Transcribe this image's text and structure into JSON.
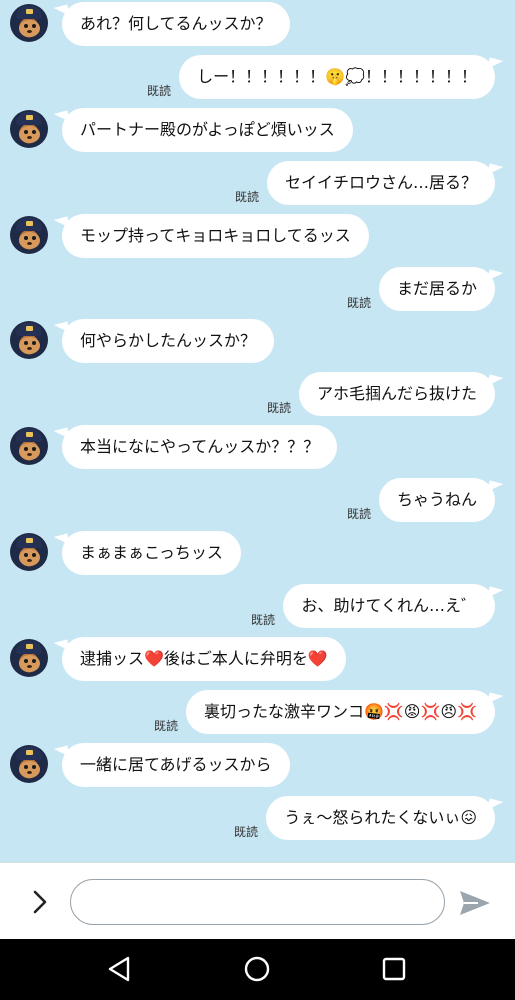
{
  "chat": {
    "read_label": "既読",
    "messages": [
      {
        "dir": "in",
        "text": "あれ？何してるんッスか？"
      },
      {
        "dir": "out",
        "text": "しー！！！！！！🤫💭！！！！！！！",
        "read": true
      },
      {
        "dir": "in",
        "text": "パートナー殿のがよっぽど煩いッス"
      },
      {
        "dir": "out",
        "text": "セイイチロウさん…居る？",
        "read": true
      },
      {
        "dir": "in",
        "text": "モップ持ってキョロキョロしてるッス"
      },
      {
        "dir": "out",
        "text": "まだ居るか",
        "read": true
      },
      {
        "dir": "in",
        "text": "何やらかしたんッスか？"
      },
      {
        "dir": "out",
        "text": "アホ毛掴んだら抜けた",
        "read": true
      },
      {
        "dir": "in",
        "text": "本当になにやってんッスか？？？"
      },
      {
        "dir": "out",
        "text": "ちゃうねん",
        "read": true
      },
      {
        "dir": "in",
        "text": "まぁまぁこっちッス"
      },
      {
        "dir": "out",
        "text": "お、助けてくれん…え゛",
        "read": true
      },
      {
        "dir": "in",
        "text": "逮捕ッス❤️後はご本人に弁明を❤️"
      },
      {
        "dir": "out",
        "text": "裏切ったな激辛ワンコ🤬💢😡💢😠💢",
        "read": true
      },
      {
        "dir": "in",
        "text": "一緒に居てあげるッスから"
      },
      {
        "dir": "out",
        "text": "うぇ〜怒られたくないぃ😖",
        "read": true
      }
    ]
  },
  "input": {
    "value": "",
    "placeholder": ""
  },
  "icons": {
    "expand": "chevron-right-icon",
    "send": "send-icon",
    "back": "back-triangle-icon",
    "home": "home-circle-icon",
    "recents": "recents-square-icon"
  },
  "colors": {
    "chat_background": "#c7e6f3",
    "bubble": "#ffffff",
    "nav_bar": "#000000",
    "send_icon": "#9aa5ad"
  }
}
